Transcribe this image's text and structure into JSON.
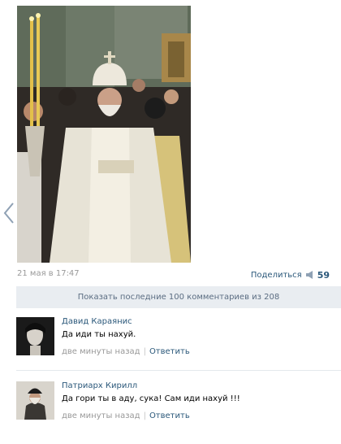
{
  "post": {
    "date": "21 мая в 17:47",
    "share_label": "Поделиться",
    "likes": "59"
  },
  "comments_bar": {
    "label": "Показать последние 100 комментариев из 208"
  },
  "comments": [
    {
      "author": "Давид Караянис",
      "text": "Да иди ты нахуй.",
      "time": "две минуты назад",
      "reply_label": "Ответить"
    },
    {
      "author": "Патриарх Кирилл",
      "text": "Да гори ты в аду, сука! Сам иди нахуй !!!",
      "time": "две минуты назад",
      "reply_label": "Ответить"
    }
  ],
  "colors": {
    "link": "#2b587a",
    "muted": "#999999",
    "bar_bg": "#e9edf1",
    "bar_text": "#5b6d82"
  },
  "icons": [
    "arrow-left-icon",
    "megaphone-icon"
  ]
}
